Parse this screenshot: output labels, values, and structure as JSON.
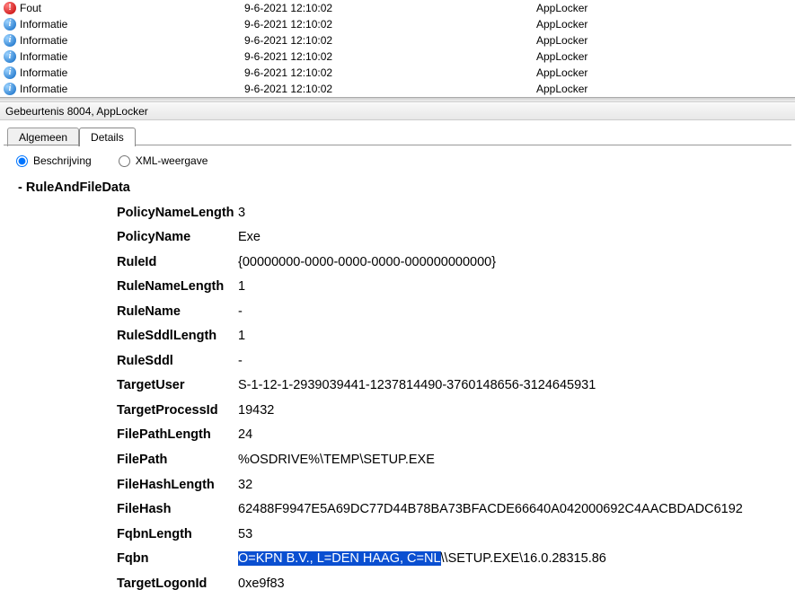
{
  "events": [
    {
      "icon": "error",
      "level": "Fout",
      "date": "9-6-2021 12:10:02",
      "source": "AppLocker"
    },
    {
      "icon": "info",
      "level": "Informatie",
      "date": "9-6-2021 12:10:02",
      "source": "AppLocker"
    },
    {
      "icon": "info",
      "level": "Informatie",
      "date": "9-6-2021 12:10:02",
      "source": "AppLocker"
    },
    {
      "icon": "info",
      "level": "Informatie",
      "date": "9-6-2021 12:10:02",
      "source": "AppLocker"
    },
    {
      "icon": "info",
      "level": "Informatie",
      "date": "9-6-2021 12:10:02",
      "source": "AppLocker"
    },
    {
      "icon": "info",
      "level": "Informatie",
      "date": "9-6-2021 12:10:02",
      "source": "AppLocker"
    }
  ],
  "panel": {
    "title": "Gebeurtenis 8004, AppLocker"
  },
  "tabs": {
    "algemeen": "Algemeen",
    "details": "Details",
    "active": "details"
  },
  "view": {
    "beschrijving": "Beschrijving",
    "xml": "XML-weergave",
    "selected": "beschrijving"
  },
  "section": {
    "title": "RuleAndFileData"
  },
  "fields": [
    {
      "key": "PolicyNameLength",
      "val": "3"
    },
    {
      "key": "PolicyName",
      "val": "Exe"
    },
    {
      "key": "RuleId",
      "val": "{00000000-0000-0000-0000-000000000000}"
    },
    {
      "key": "RuleNameLength",
      "val": "1"
    },
    {
      "key": "RuleName",
      "val": "-"
    },
    {
      "key": "RuleSddlLength",
      "val": "1"
    },
    {
      "key": "RuleSddl",
      "val": "-"
    },
    {
      "key": "TargetUser",
      "val": "S-1-12-1-2939039441-1237814490-3760148656-3124645931"
    },
    {
      "key": "TargetProcessId",
      "val": "19432"
    },
    {
      "key": "FilePathLength",
      "val": "24"
    },
    {
      "key": "FilePath",
      "val": "%OSDRIVE%\\TEMP\\SETUP.EXE"
    },
    {
      "key": "FileHashLength",
      "val": "32"
    },
    {
      "key": "FileHash",
      "val": "62488F9947E5A69DC77D44B78BA73BFACDE66640A042000692C4AACBDADC6192"
    },
    {
      "key": "FqbnLength",
      "val": "53"
    }
  ],
  "fqbn": {
    "key": "Fqbn",
    "highlighted": "O=KPN B.V., L=DEN HAAG, C=NL",
    "rest": "\\\\SETUP.EXE\\16.0.28315.86"
  },
  "lastfield": {
    "key": "TargetLogonId",
    "val": "0xe9f83"
  }
}
